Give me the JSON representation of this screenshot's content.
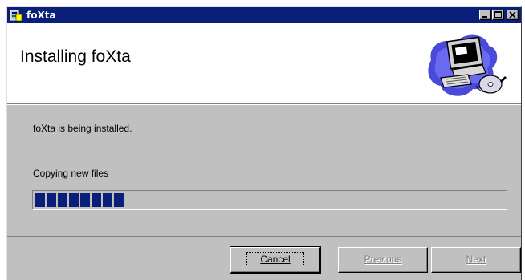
{
  "window": {
    "title": "foXta",
    "controls": {
      "minimize": "minimize-icon",
      "maximize": "maximize-icon",
      "close": "close-icon"
    }
  },
  "header": {
    "title": "Installing foXta",
    "graphic": "computer-setup-illustration-icon"
  },
  "body": {
    "message": "foXta is being installed.",
    "status": "Copying new files",
    "progress_blocks": 8,
    "progress_total_blocks": 42
  },
  "buttons": {
    "cancel": "Cancel",
    "previous": "Previous",
    "next": "Next"
  },
  "colors": {
    "titlebar": "#0a1f7a",
    "progress": "#0a1f7a",
    "face": "#c0c0c0"
  }
}
